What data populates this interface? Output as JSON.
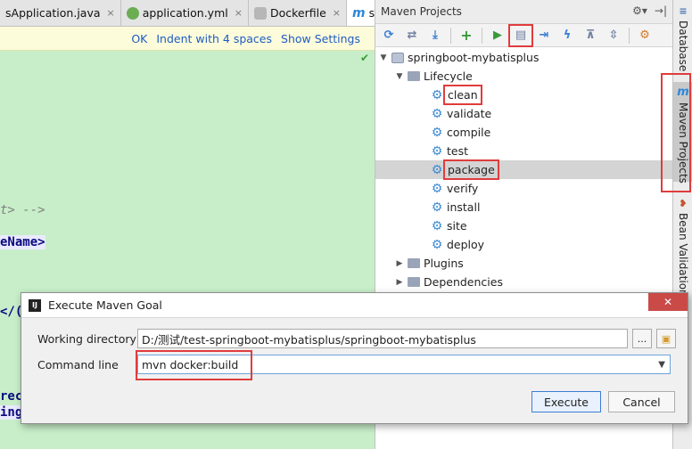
{
  "editor": {
    "tabs": [
      {
        "label": "sApplication.java",
        "icon": "java-class-icon",
        "color": "#e37d3a"
      },
      {
        "label": "application.yml",
        "icon": "yaml-icon",
        "color": "#6cad53"
      },
      {
        "label": "Dockerfile",
        "icon": "docker-file-icon",
        "color": "#8a8a8a"
      },
      {
        "label": "spr",
        "icon": "maven-m-icon",
        "color": "#2e87d8"
      }
    ],
    "close_glyph": "×",
    "notice": {
      "ok": "OK",
      "indent": "Indent with 4 spaces",
      "settings": "Show Settings"
    },
    "code_lines": [
      {
        "text": "t> -->"
      },
      {
        "text": "eName>"
      },
      {
        "text": "</("
      },
      {
        "text": "rec"
      },
      {
        "text": "ing"
      }
    ],
    "check_glyph": "✔"
  },
  "maven": {
    "title": "Maven Projects",
    "header_tools": {
      "gear": "⚙▾",
      "pin": "→|"
    },
    "toolbar_icons": [
      {
        "name": "reimport-icon",
        "glyph": "⟳",
        "color": "#3b7fd2"
      },
      {
        "name": "generate-sources-icon",
        "glyph": "⇄",
        "color": "#6f7fa0"
      },
      {
        "name": "download-sources-icon",
        "glyph": "⤓",
        "color": "#3b7fd2"
      },
      {
        "name": "add-project-icon",
        "glyph": "+",
        "color": "#3a9a3a"
      },
      {
        "name": "run-icon",
        "glyph": "▶",
        "color": "#3a9a3a"
      },
      {
        "name": "execute-goal-icon",
        "glyph": "▤",
        "color": "#6f7fa0"
      },
      {
        "name": "toggle-offline-icon",
        "glyph": "⇥",
        "color": "#3b7fd2"
      },
      {
        "name": "skip-tests-icon",
        "glyph": "ϟ",
        "color": "#3b7fd2"
      },
      {
        "name": "show-dependencies-icon",
        "glyph": "⊼",
        "color": "#6f7fa0"
      },
      {
        "name": "collapse-all-icon",
        "glyph": "⇳",
        "color": "#6f7fa0"
      },
      {
        "name": "maven-settings-icon",
        "glyph": "⚙",
        "color": "#d07a2a"
      }
    ],
    "project": "springboot-mybatisplus",
    "lifecycle_label": "Lifecycle",
    "goals": [
      "clean",
      "validate",
      "compile",
      "test",
      "package",
      "verify",
      "install",
      "site",
      "deploy"
    ],
    "plugins_label": "Plugins",
    "dependencies_label": "Dependencies",
    "selected_goal": "package"
  },
  "side_tabs": {
    "database": "Database",
    "maven": "Maven Projects",
    "bean": "Bean Validation",
    "maven_glyph": "m",
    "db_glyph": "≡",
    "bean_glyph": "❥"
  },
  "dialog": {
    "title": "Execute Maven Goal",
    "app_glyph": "IJ",
    "close_glyph": "✕",
    "working_dir_label": "Working directory",
    "working_dir_value": "D:/测试/test-springboot-mybatisplus/springboot-mybatisplus",
    "browse_glyph": "...",
    "command_line_label": "Command line",
    "command_line_value": "mvn docker:build",
    "execute_label": "Execute",
    "cancel_label": "Cancel"
  },
  "colors": {
    "highlight_box": "#e03c3c",
    "editor_bg": "#c7eec9",
    "maven_blue": "#3d8bd4"
  }
}
